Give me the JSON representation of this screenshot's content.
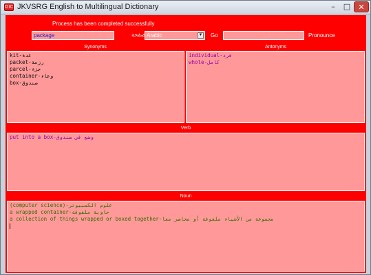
{
  "window": {
    "title": "JKVSRG English to Multilingual Dictionary",
    "app_icon_text": "DIC",
    "minimize": "–",
    "maximize": "□",
    "close": "✕"
  },
  "status_text": "Process has been completed successfully",
  "search": {
    "value": "package",
    "language_label": "صفحة",
    "language_selected": "Arabic",
    "go_label": "Go",
    "translation_value": "",
    "pronounce_label": "Pronounce"
  },
  "synonyms": {
    "header": "Synonyms",
    "items": [
      "kit-عدة",
      "packet-رزمة",
      "parcel-جزء",
      "container-وعاء",
      "box-صندوق"
    ]
  },
  "antonyms": {
    "header": "Antonyms",
    "items": [
      "individual-فرد",
      "whole-كامل"
    ]
  },
  "verb": {
    "header": "Verb",
    "items": [
      "put into a box-وضع في صندوق"
    ]
  },
  "noun": {
    "header": "Noun",
    "items": [
      "(computer science)-علوم الكمبيوتر",
      "a wrapped container-حاوية ملفوفة",
      "a collection of things wrapped or boxed together-مجموعة من الأشياء ملفوفة أو محاصر معا"
    ]
  },
  "colors": {
    "background": "#ff0000",
    "pane": "#ff9999",
    "antonym_text": "#9900aa",
    "noun_text": "#3a6b00"
  }
}
